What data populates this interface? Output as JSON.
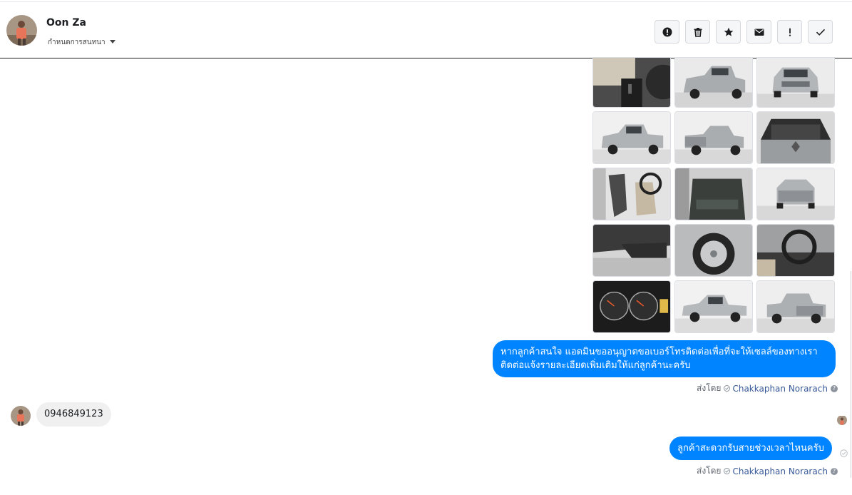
{
  "header": {
    "contact_name": "Oon Za",
    "subtitle": "กำหนดการสนทนา",
    "actions": [
      {
        "name": "spam",
        "icon": "alert-circle-icon"
      },
      {
        "name": "delete",
        "icon": "trash-icon"
      },
      {
        "name": "star",
        "icon": "star-icon"
      },
      {
        "name": "mark-unread",
        "icon": "envelope-icon"
      },
      {
        "name": "important",
        "icon": "exclamation-icon"
      },
      {
        "name": "done",
        "icon": "check-icon"
      }
    ]
  },
  "photos": [
    {
      "subject": "car-interior-gear"
    },
    {
      "subject": "silver-pickup-front-angle"
    },
    {
      "subject": "silver-pickup-front"
    },
    {
      "subject": "silver-pickup-side-front"
    },
    {
      "subject": "silver-pickup-rear-angle"
    },
    {
      "subject": "engine-bay"
    },
    {
      "subject": "front-seats"
    },
    {
      "subject": "rear-seat"
    },
    {
      "subject": "silver-pickup-rear"
    },
    {
      "subject": "door-panel"
    },
    {
      "subject": "wheel"
    },
    {
      "subject": "steering-wheel"
    },
    {
      "subject": "speedometer"
    },
    {
      "subject": "silver-pickup-side"
    },
    {
      "subject": "silver-pickup-rear-quarter"
    }
  ],
  "messages": {
    "outgoing_1": "หากลูกค้าสนใจ แอดมินขออนุญาตขอเบอร์โทรติดต่อเพื่อที่จะให้เซลล์ของทางเราติดต่อแจ้งรายละเอียดเพิ่มเติมให้แก่ลูกค้านะครับ",
    "incoming_1": "0946849123",
    "outgoing_2": "ลูกค้าสะดวกรับสายช่วงเวลาไหนครับ"
  },
  "sent_by": {
    "prefix": "ส่งโดย",
    "agent": "Chakkaphan Norarach",
    "help_glyph": "?"
  },
  "colors": {
    "outgoing_bubble": "#0084ff",
    "incoming_bubble": "#f0f0f0",
    "agent_link": "#385898"
  }
}
